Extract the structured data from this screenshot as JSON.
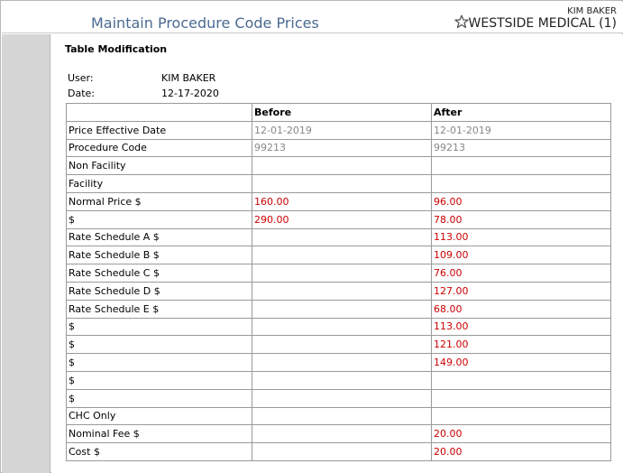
{
  "header": {
    "title": "Maintain Procedure Code Prices",
    "user": "KIM BAKER",
    "practice": "WESTSIDE MEDICAL (1)",
    "favorite_icon": "star-outline-icon"
  },
  "section": {
    "title": "Table Modification"
  },
  "info": [
    {
      "label": "User:",
      "value": "KIM BAKER"
    },
    {
      "label": "Date:",
      "value": "12-17-2020"
    }
  ],
  "table": {
    "columns": [
      "",
      "Before",
      "After"
    ],
    "rows": [
      {
        "label": "Price Effective Date",
        "before": "12-01-2019",
        "after": "12-01-2019",
        "style": "gray"
      },
      {
        "label": "Procedure Code",
        "before": "99213",
        "after": "99213",
        "style": "gray"
      },
      {
        "label": "Non Facility",
        "before": "",
        "after": "",
        "style": "red"
      },
      {
        "label": "Facility",
        "before": "",
        "after": "",
        "style": "red"
      },
      {
        "label": "Normal Price $",
        "before": "160.00",
        "after": "96.00",
        "style": "red"
      },
      {
        "label": "$",
        "before": "290.00",
        "after": "78.00",
        "style": "red"
      },
      {
        "label": "Rate Schedule A $",
        "before": "",
        "after": "113.00",
        "style": "red"
      },
      {
        "label": "Rate Schedule B $",
        "before": "",
        "after": "109.00",
        "style": "red"
      },
      {
        "label": "Rate Schedule C $",
        "before": "",
        "after": "76.00",
        "style": "red"
      },
      {
        "label": "Rate Schedule D $",
        "before": "",
        "after": "127.00",
        "style": "red"
      },
      {
        "label": "Rate Schedule E $",
        "before": "",
        "after": "68.00",
        "style": "red"
      },
      {
        "label": "$",
        "before": "",
        "after": "113.00",
        "style": "red"
      },
      {
        "label": "$",
        "before": "",
        "after": "121.00",
        "style": "red"
      },
      {
        "label": "$",
        "before": "",
        "after": "149.00",
        "style": "red"
      },
      {
        "label": "$",
        "before": "",
        "after": "",
        "style": "red"
      },
      {
        "label": "$",
        "before": "",
        "after": "",
        "style": "red"
      },
      {
        "label": "CHC Only",
        "before": "",
        "after": "",
        "style": "red"
      },
      {
        "label": "Nominal Fee $",
        "before": "",
        "after": "20.00",
        "style": "red"
      },
      {
        "label": "Cost $",
        "before": "",
        "after": "20.00",
        "style": "red"
      }
    ]
  },
  "colors": {
    "title": "#4a6a90",
    "changed_value": "#cc0000",
    "unchanged_value": "#888888",
    "sidebar": "#d6d6d6"
  }
}
